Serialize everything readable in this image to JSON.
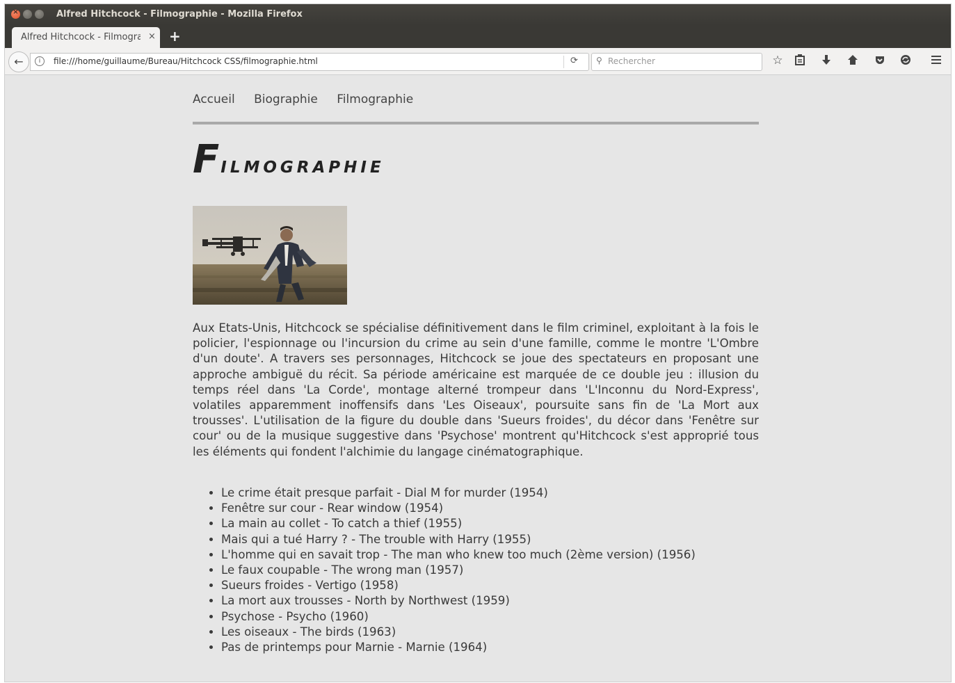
{
  "window": {
    "title": "Alfred Hitchcock - Filmographie - Mozilla Firefox"
  },
  "tab": {
    "label": "Alfred Hitchcock - Filmographie",
    "close": "×",
    "new_tab": "+"
  },
  "navbar": {
    "back_icon": "←",
    "url": "file:///home/guillaume/Bureau/Hitchcock CSS/filmographie.html",
    "reload_icon": "⟳",
    "search_placeholder": "Rechercher",
    "icons": [
      "star-icon",
      "clipboard-icon",
      "download-icon",
      "home-icon",
      "pocket-icon",
      "sync-icon",
      "menu-icon"
    ]
  },
  "page": {
    "menu": [
      "Accueil",
      "Biographie",
      "Filmographie"
    ],
    "heading_cap": "F",
    "heading_rest": "ilmographie",
    "paragraph": "Aux Etats-Unis, Hitchcock se spécialise définitivement dans le film criminel, exploitant à la fois le policier, l'espionnage ou l'incursion du crime au sein d'une famille, comme le montre 'L'Ombre d'un doute'. A travers ses personnages, Hitchcock se joue des spectateurs en proposant une approche ambiguë du récit. Sa période américaine est marquée de ce double jeu : illusion du temps réel dans 'La Corde', montage alterné trompeur dans 'L'Inconnu du Nord-Express', volatiles apparemment inoffensifs dans 'Les Oiseaux', poursuite sans fin de 'La Mort aux trousses'. L'utilisation de la figure du double dans 'Sueurs froides', du décor dans 'Fenêtre sur cour' ou de la musique suggestive dans 'Psychose' montrent qu'Hitchcock s'est approprié tous les éléments qui fondent l'alchimie du langage cinématographique.",
    "films": [
      "Le crime était presque parfait - Dial M for murder (1954)",
      "Fenêtre sur cour - Rear window (1954)",
      "La main au collet - To catch a thief (1955)",
      "Mais qui a tué Harry ? - The trouble with Harry (1955)",
      "L'homme qui en savait trop - The man who knew too much (2ème version) (1956)",
      "Le faux coupable - The wrong man (1957)",
      "Sueurs froides - Vertigo (1958)",
      "La mort aux trousses - North by Northwest (1959)",
      "Psychose - Psycho (1960)",
      "Les oiseaux - The birds (1963)",
      "Pas de printemps pour Marnie - Marnie (1964)"
    ]
  }
}
